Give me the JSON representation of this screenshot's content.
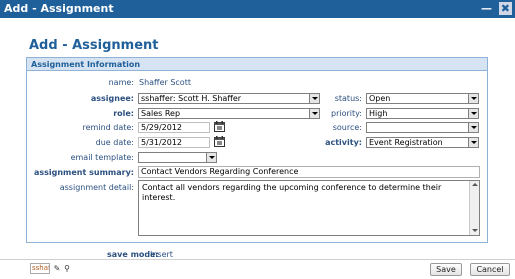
{
  "window": {
    "title": "Add - Assignment",
    "controls": [
      "minimize-icon",
      "close-icon"
    ]
  },
  "page_title": "Add - Assignment",
  "section": {
    "title": "Assignment Information",
    "name_label": "name:",
    "name_value": "Shaffer Scott",
    "assignee_label": "assignee:",
    "assignee_value": "sshaffer: Scott H. Shaffer",
    "role_label": "role:",
    "role_value": "Sales Rep",
    "remind_date_label": "remind date:",
    "remind_date_value": "5/29/2012",
    "due_date_label": "due date:",
    "due_date_value": "5/31/2012",
    "email_template_label": "email template:",
    "email_template_value": "",
    "status_label": "status:",
    "status_value": "Open",
    "priority_label": "priority:",
    "priority_value": "High",
    "source_label": "source:",
    "source_value": "",
    "activity_label": "activity:",
    "activity_value": "Event Registration",
    "summary_label": "assignment summary:",
    "summary_value": "Contact Vendors Regarding Conference",
    "detail_label": "assignment detail:",
    "detail_value": "Contact all vendors regarding the upcoming conference to determine their interest."
  },
  "footer": {
    "save_mode_label": "save mode:",
    "save_mode_value": "Insert",
    "user": "sshaffer",
    "save_label": "Save",
    "cancel_label": "Cancel"
  }
}
